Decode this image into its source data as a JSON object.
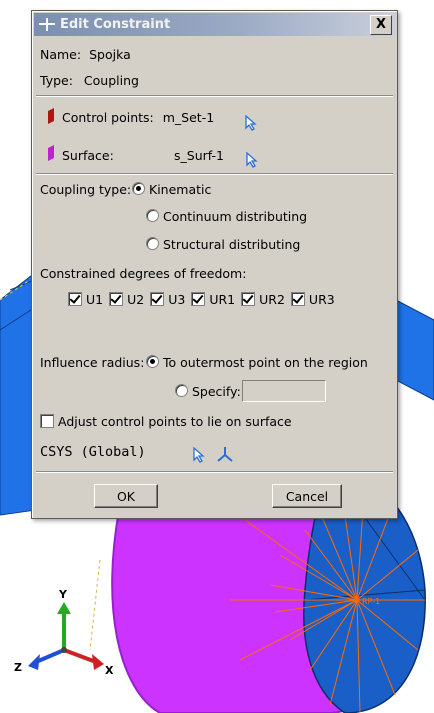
{
  "dialog": {
    "title": "Edit Constraint",
    "close_label": "X",
    "name_label": "Name:",
    "name_value": "Spojka",
    "type_label": "Type:",
    "type_value": "Coupling",
    "control_points_label": "Control points:",
    "control_points_value": "m_Set-1",
    "surface_label": "Surface:",
    "surface_value": "s_Surf-1",
    "coupling_type_label": "Coupling type:",
    "coupling_options": [
      "Kinematic",
      "Continuum distributing",
      "Structural distributing"
    ],
    "coupling_selected": "Kinematic",
    "dof_label": "Constrained degrees of freedom:",
    "dof": [
      {
        "label": "U1",
        "checked": true
      },
      {
        "label": "U2",
        "checked": true
      },
      {
        "label": "U3",
        "checked": true
      },
      {
        "label": "UR1",
        "checked": true
      },
      {
        "label": "UR2",
        "checked": true
      },
      {
        "label": "UR3",
        "checked": true
      }
    ],
    "influence_label": "Influence radius:",
    "influence_options": [
      "To outermost point on the region",
      "Specify:"
    ],
    "influence_selected": "To outermost point on the region",
    "specify_value": "",
    "adjust_label": "Adjust control points to lie on surface",
    "adjust_checked": false,
    "csys_label": "CSYS (Global)",
    "ok_label": "OK",
    "cancel_label": "Cancel"
  },
  "viewport": {
    "triad": {
      "y": "Y",
      "z": "Z",
      "x": "X"
    },
    "ref_point_label": "RP-1"
  },
  "colors": {
    "model_blue": "#1f73e6",
    "model_magenta": "#cc33ff",
    "coupling_lines": "#ff6a00",
    "dialog_bg": "#d4d0c8",
    "control_points_marker": "#b01515",
    "surface_marker": "#c020d0"
  },
  "icons": [
    "edit-constraint-icon",
    "close-icon",
    "control-points-icon",
    "surface-icon",
    "select-arrow-icon",
    "csys-select-arrow-icon",
    "csys-axes-icon",
    "triad-icon"
  ]
}
